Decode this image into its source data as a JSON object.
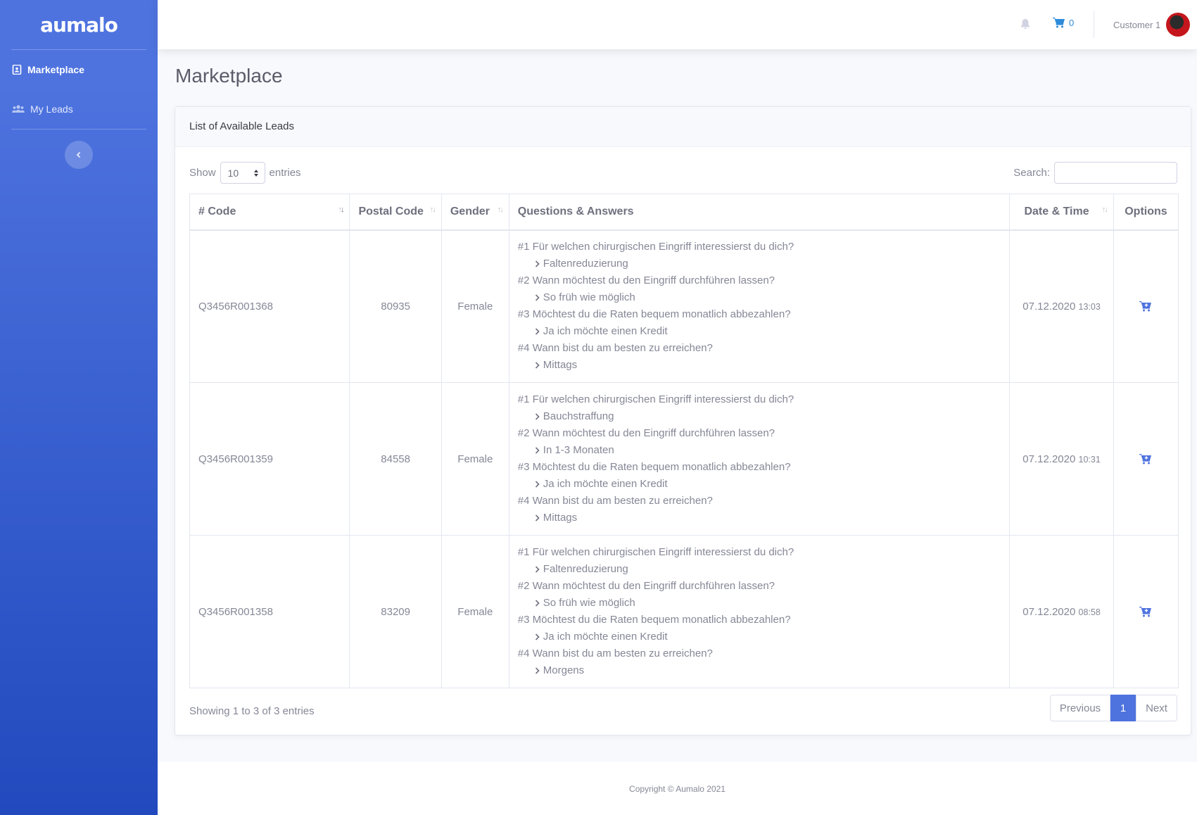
{
  "brand": {
    "name": "aumalo"
  },
  "sidebar": {
    "items": [
      {
        "label": "Marketplace",
        "icon": "address-book-icon",
        "active": true
      },
      {
        "label": "My Leads",
        "icon": "users-icon",
        "active": false
      }
    ],
    "toggle_icon": "chevron-left-icon"
  },
  "topbar": {
    "bell_icon": "bell-icon",
    "cart_icon": "shopping-cart-icon",
    "cart_count": "0",
    "user_name": "Customer 1"
  },
  "page": {
    "title": "Marketplace"
  },
  "card": {
    "title": "List of Available Leads",
    "show_label": "Show",
    "entries_value": "10",
    "entries_label": "entries",
    "search_label": "Search:",
    "search_value": ""
  },
  "table": {
    "columns": [
      "# Code",
      "Postal Code",
      "Gender",
      "Questions & Answers",
      "Date & Time",
      "Options"
    ],
    "rows": [
      {
        "code": "Q3456R001368",
        "postal": "80935",
        "gender": "Female",
        "qa": [
          {
            "q": "#1 Für welchen chirurgischen Eingriff interessierst du dich?",
            "a": "Faltenreduzierung"
          },
          {
            "q": "#2 Wann möchtest du den Eingriff durchführen lassen?",
            "a": "So früh wie möglich"
          },
          {
            "q": "#3 Möchtest du die Raten bequem monatlich abbezahlen?",
            "a": "Ja ich möchte einen Kredit"
          },
          {
            "q": "#4 Wann bist du am besten zu erreichen?",
            "a": "Mittags"
          }
        ],
        "date": "07.12.2020",
        "time": "13:03"
      },
      {
        "code": "Q3456R001359",
        "postal": "84558",
        "gender": "Female",
        "qa": [
          {
            "q": "#1 Für welchen chirurgischen Eingriff interessierst du dich?",
            "a": "Bauchstraffung"
          },
          {
            "q": "#2 Wann möchtest du den Eingriff durchführen lassen?",
            "a": "In 1-3 Monaten"
          },
          {
            "q": "#3 Möchtest du die Raten bequem monatlich abbezahlen?",
            "a": "Ja ich möchte einen Kredit"
          },
          {
            "q": "#4 Wann bist du am besten zu erreichen?",
            "a": "Mittags"
          }
        ],
        "date": "07.12.2020",
        "time": "10:31"
      },
      {
        "code": "Q3456R001358",
        "postal": "83209",
        "gender": "Female",
        "qa": [
          {
            "q": "#1 Für welchen chirurgischen Eingriff interessierst du dich?",
            "a": "Faltenreduzierung"
          },
          {
            "q": "#2 Wann möchtest du den Eingriff durchführen lassen?",
            "a": "So früh wie möglich"
          },
          {
            "q": "#3 Möchtest du die Raten bequem monatlich abbezahlen?",
            "a": "Ja ich möchte einen Kredit"
          },
          {
            "q": "#4 Wann bist du am besten zu erreichen?",
            "a": "Morgens"
          }
        ],
        "date": "07.12.2020",
        "time": "08:58"
      }
    ]
  },
  "pagination": {
    "info": "Showing 1 to 3 of 3 entries",
    "previous": "Previous",
    "current": "1",
    "next": "Next"
  },
  "footer": {
    "text": "Copyright © Aumalo 2021"
  },
  "colors": {
    "primary": "#4e73df",
    "sidebar_gradient_end": "#224abe",
    "cart_blue": "#2e8bd9"
  }
}
